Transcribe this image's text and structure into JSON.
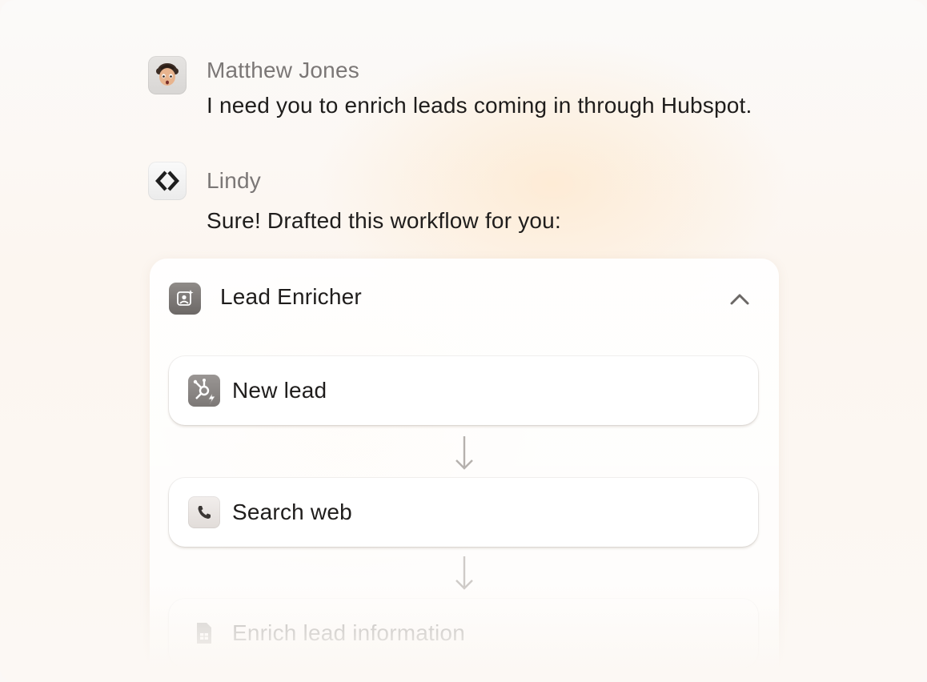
{
  "conversation": {
    "user": {
      "name": "Matthew Jones",
      "message": "I need you to enrich leads coming in through Hubspot.",
      "avatar_icon": "memoji-avatar"
    },
    "assistant": {
      "name": "Lindy",
      "message": "Sure! Drafted this workflow for you:",
      "avatar_icon": "lindy-logo-icon"
    }
  },
  "workflow": {
    "title": "Lead Enricher",
    "icon": "sparkle-user-icon",
    "expanded": true,
    "steps": [
      {
        "label": "New lead",
        "icon": "hubspot-trigger-icon"
      },
      {
        "label": "Search web",
        "icon": "phone-icon"
      },
      {
        "label": "Enrich lead information",
        "icon": "sheet-icon"
      }
    ]
  },
  "colors": {
    "text_primary": "#1f1d1c",
    "text_secondary": "#7b7776",
    "accent_warm": "#ffe2be"
  }
}
